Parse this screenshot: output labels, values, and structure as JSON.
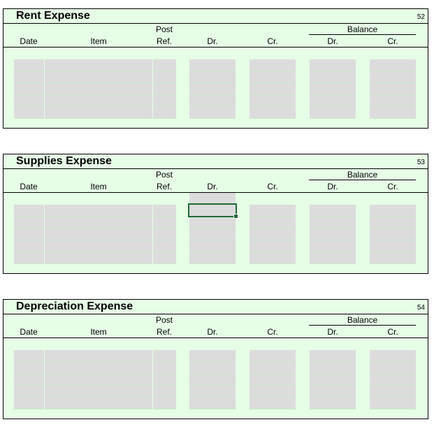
{
  "ledgers": [
    {
      "title": "Rent Expense",
      "number": "52"
    },
    {
      "title": "Supplies Expense",
      "number": "53"
    },
    {
      "title": "Depreciation Expense",
      "number": "54"
    }
  ],
  "headers": {
    "post": "Post",
    "balance": "Balance",
    "date": "Date",
    "item": "Item",
    "ref": "Ref.",
    "dr": "Dr.",
    "cr": "Cr.",
    "bal_dr": "Dr.",
    "bal_cr": "Cr."
  },
  "colors": {
    "sheet_bg": "#e6fde6",
    "cell_bg": "#dcdcdc",
    "selection": "#1e6b34"
  }
}
